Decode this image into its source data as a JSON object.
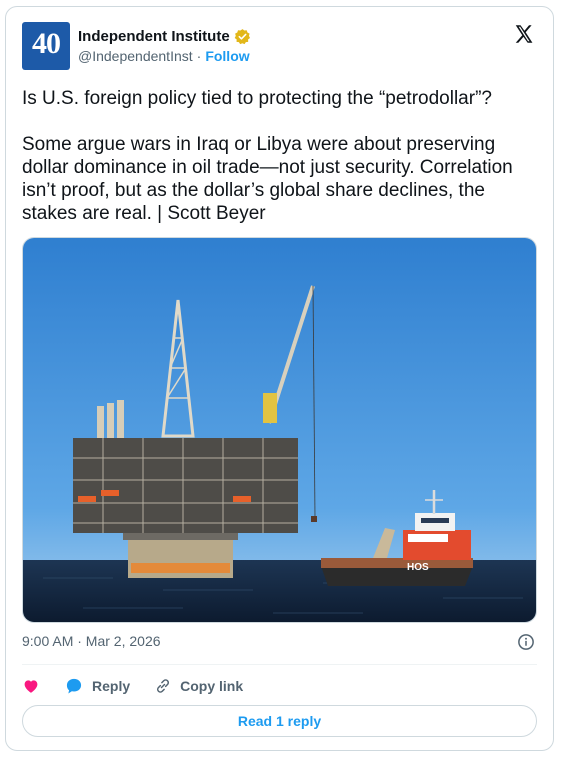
{
  "account": {
    "name": "Independent Institute",
    "handle": "@IndependentInst",
    "separator": "·",
    "follow_label": "Follow",
    "avatar_text": "40",
    "verified": true,
    "avatar_color": "#1d5aa8",
    "badge_color": "#e2b719"
  },
  "tweet": {
    "text": "Is U.S. foreign policy tied to protecting the “petrodollar”?\n\nSome argue wars in Iraq or Libya were about preserving dollar dominance in oil trade—not just security. Correlation isn’t proof, but as the dollar’s global share declines, the stakes are real. | Scott Beyer",
    "timestamp": "9:00 AM · Mar 2, 2026",
    "image_alt": "offshore-oil-platform-and-supply-vessel-photo",
    "vessel_name": "HOS"
  },
  "actions": {
    "reply_label": "Reply",
    "copy_link_label": "Copy link",
    "read_replies_label": "Read 1 reply"
  },
  "icons": {
    "x_logo": "x-logo-icon",
    "verified": "verified-badge-icon",
    "info": "info-icon",
    "heart": "heart-icon",
    "reply": "reply-bubble-icon",
    "link": "link-icon"
  },
  "colors": {
    "accent": "#1d9bf0",
    "heart": "#f91880",
    "text": "#0f1419",
    "secondary": "#536471"
  }
}
